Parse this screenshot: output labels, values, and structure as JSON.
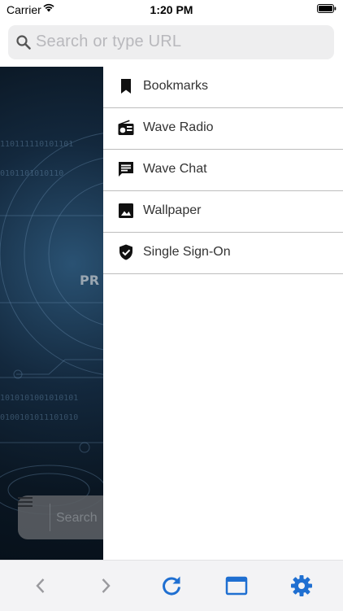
{
  "status_bar": {
    "carrier": "Carrier",
    "time": "1:20 PM"
  },
  "url_bar": {
    "placeholder": "Search or type URL"
  },
  "background_page": {
    "search_label": "Search"
  },
  "drawer": {
    "items": [
      {
        "label": "Bookmarks",
        "icon": "bookmark-icon"
      },
      {
        "label": "Wave Radio",
        "icon": "radio-icon"
      },
      {
        "label": "Wave Chat",
        "icon": "chat-icon"
      },
      {
        "label": "Wallpaper",
        "icon": "image-icon"
      },
      {
        "label": "Single Sign-On",
        "icon": "shield-icon"
      }
    ]
  },
  "toolbar": {
    "buttons": [
      "back-icon",
      "forward-icon",
      "reload-icon",
      "tabs-icon",
      "settings-icon"
    ],
    "accent_color": "#1f6fd1",
    "disabled_color": "#9a9a9e"
  }
}
